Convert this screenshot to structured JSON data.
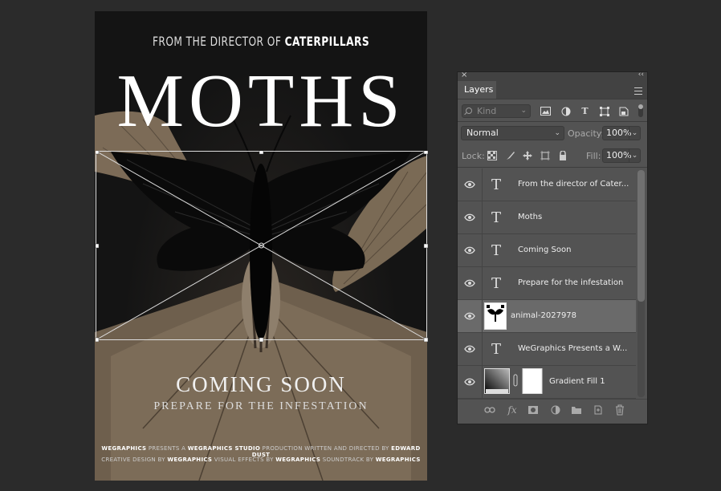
{
  "poster": {
    "pre_title_prefix": "FROM THE DIRECTOR OF",
    "pre_title_bold": "CATERPILLARS",
    "title": "MOTHS",
    "coming_soon": "COMING SOON",
    "tagline": "PREPARE FOR THE INFESTATION",
    "credits_line1": [
      {
        "text": "WEGRAPHICS",
        "bold": true
      },
      {
        "text": " PRESENTS A ",
        "bold": false
      },
      {
        "text": "WEGRAPHICS STUDIO",
        "bold": true
      },
      {
        "text": " PRODUCTION WRITTEN AND DIRECTED BY ",
        "bold": false
      },
      {
        "text": "EDWARD DUST",
        "bold": true
      }
    ],
    "credits_line2": [
      {
        "text": "CREATIVE DESIGN BY ",
        "bold": false
      },
      {
        "text": "WEGRAPHICS",
        "bold": true
      },
      {
        "text": " VISUAL EFFECTS BY ",
        "bold": false
      },
      {
        "text": "WEGRAPHICS",
        "bold": true
      },
      {
        "text": " SOUNDTRACK BY ",
        "bold": false
      },
      {
        "text": "WEGRAPHICS",
        "bold": true
      }
    ]
  },
  "panel": {
    "close_glyph": "×",
    "collapse_glyph": "‹‹",
    "tab_label": "Layers",
    "kind_placeholder": "Kind",
    "blend_mode": "Normal",
    "opacity_label": "Opacity:",
    "opacity_value": "100%",
    "lock_label": "Lock:",
    "fill_label": "Fill:",
    "fill_value": "100%",
    "layers": [
      {
        "name": "From the director of Cater...",
        "type": "text",
        "selected": false
      },
      {
        "name": "Moths",
        "type": "text",
        "selected": false
      },
      {
        "name": "Coming Soon",
        "type": "text",
        "selected": false
      },
      {
        "name": "Prepare for the infestation",
        "type": "text",
        "selected": false
      },
      {
        "name": "animal-2027978",
        "type": "image",
        "selected": true
      },
      {
        "name": "WeGraphics Presents a W...",
        "type": "text",
        "selected": false
      },
      {
        "name": "Gradient Fill 1",
        "type": "fill",
        "selected": false
      }
    ]
  },
  "icons": {
    "filter": [
      "image-filter-icon",
      "adjustment-filter-icon",
      "type-filter-icon",
      "shape-filter-icon",
      "smart-object-filter-icon"
    ],
    "lock": [
      "lock-transparent-icon",
      "lock-image-icon",
      "lock-position-icon",
      "lock-artboard-icon",
      "lock-all-icon"
    ],
    "bottom": [
      "link-layers-icon",
      "layer-style-icon",
      "layer-mask-icon",
      "adjustment-layer-icon",
      "group-icon",
      "new-layer-icon",
      "delete-icon"
    ]
  }
}
